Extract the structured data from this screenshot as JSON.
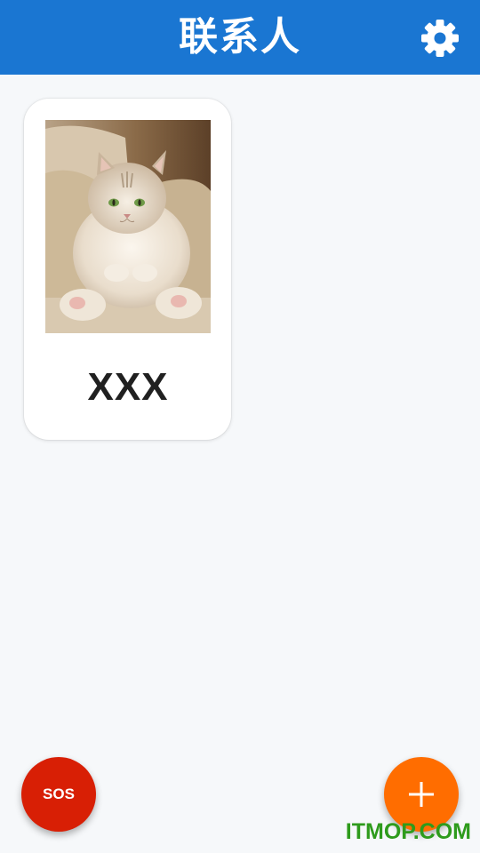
{
  "app_bar": {
    "title": "联系人",
    "background": "#1a76d2",
    "settings_icon": "gear-icon"
  },
  "contacts": [
    {
      "name": "XXX",
      "photo": "fluffy-cat-photo"
    }
  ],
  "sos_button": {
    "label": "SOS",
    "color": "#d81f05"
  },
  "add_button": {
    "icon": "plus-icon",
    "color": "#ff6d00"
  },
  "watermark": {
    "text": "ITMOP.COM",
    "color": "#2e9b1c"
  }
}
